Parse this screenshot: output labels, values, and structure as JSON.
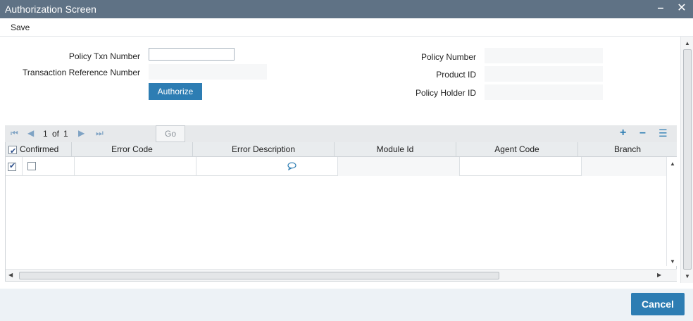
{
  "window": {
    "title": "Authorization Screen",
    "minimize_icon": "minimize-icon",
    "close_icon": "close-icon"
  },
  "menu": {
    "save_label": "Save"
  },
  "form": {
    "policy_txn_number_label": "Policy Txn Number",
    "policy_txn_number_value": "",
    "transaction_reference_number_label": "Transaction Reference Number",
    "transaction_reference_number_value": "",
    "authorize_label": "Authorize",
    "policy_number_label": "Policy Number",
    "policy_number_value": "",
    "product_id_label": "Product ID",
    "product_id_value": "",
    "policy_holder_id_label": "Policy Holder ID",
    "policy_holder_id_value": ""
  },
  "grid": {
    "page_current": "1",
    "page_of": "of",
    "page_total": "1",
    "go_label": "Go",
    "columns": [
      "Confirmed",
      "Error Code",
      "Error Description",
      "Module Id",
      "Agent Code",
      "Branch"
    ],
    "rows": [
      {
        "selected": true,
        "confirmed": false,
        "error_code": "",
        "error_description_icon": "comment-icon",
        "module_id": "",
        "agent_code": "",
        "branch": ""
      }
    ]
  },
  "footer": {
    "cancel_label": "Cancel"
  },
  "colors": {
    "titlebar": "#5f7285",
    "accent": "#2d7db3",
    "footer": "#edf2f6"
  }
}
